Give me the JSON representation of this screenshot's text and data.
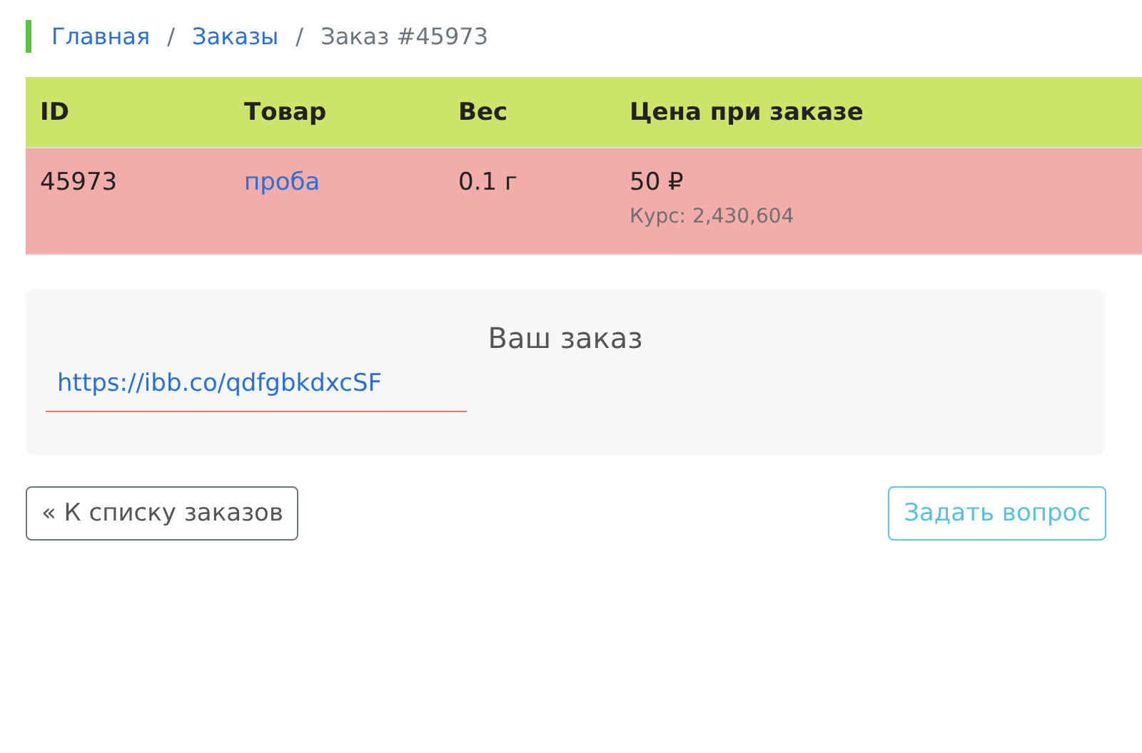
{
  "breadcrumb": [
    {
      "label": "Главная",
      "kind": "link"
    },
    {
      "label": "Заказы",
      "kind": "link",
      "separator": "/"
    },
    {
      "label": "Заказ #45973",
      "kind": "current",
      "separator": "/"
    }
  ],
  "table": {
    "columns": [
      "ID",
      "Товар",
      "Вес",
      "Цена при заказе"
    ],
    "rows": [
      {
        "id": "45973",
        "product": "проба",
        "weight": "0.1 г",
        "price": "50 ₽",
        "rate": "Курс: 2,430,604"
      }
    ]
  },
  "order_card": {
    "title": "Ваш заказ",
    "link": "https://ibb.co/qdfgbkdxcSF"
  },
  "buttons": [
    {
      "label": "« К списку заказов",
      "kind": "back"
    },
    {
      "label": "Задать вопрос",
      "kind": "question"
    }
  ]
}
